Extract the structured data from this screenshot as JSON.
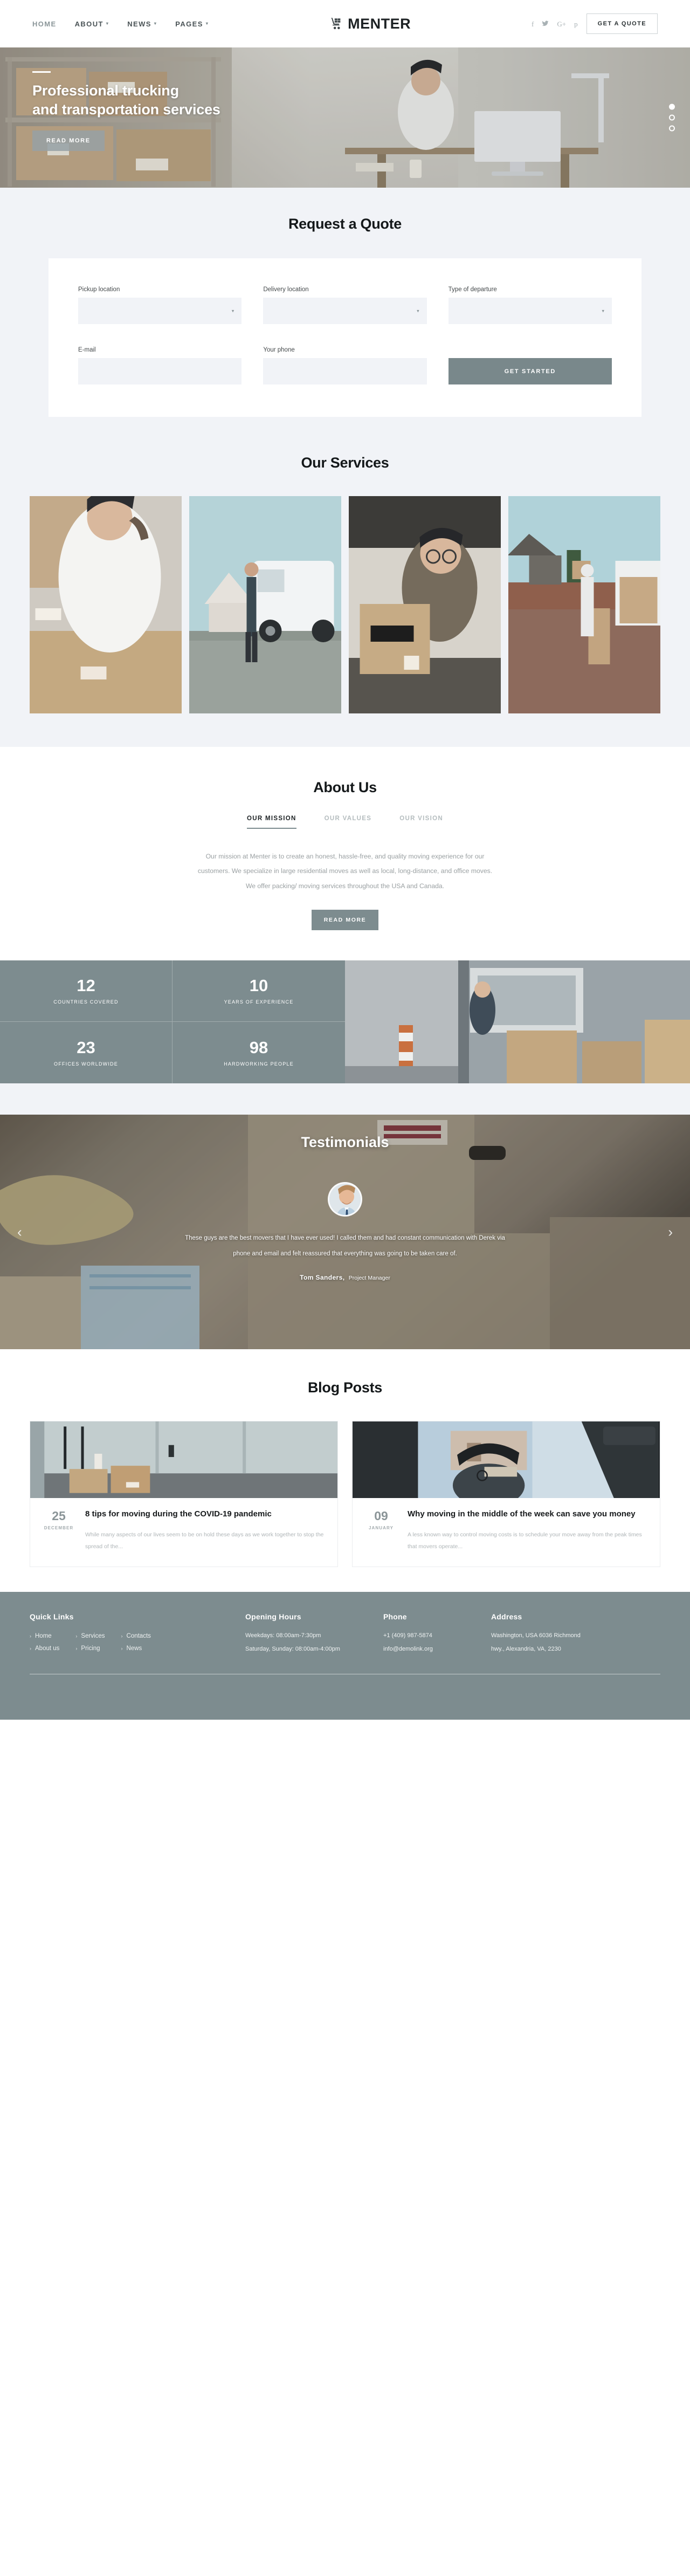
{
  "header": {
    "nav": [
      {
        "label": "HOME",
        "caret": false,
        "active": true
      },
      {
        "label": "ABOUT",
        "caret": true,
        "active": false
      },
      {
        "label": "NEWS",
        "caret": true,
        "active": false
      },
      {
        "label": "PAGES",
        "caret": true,
        "active": false
      }
    ],
    "brand_name": "MENTER",
    "socials": [
      "f",
      "t",
      "G+",
      "p"
    ],
    "quote_button": "GET A QUOTE"
  },
  "hero": {
    "title_line1": "Professional trucking",
    "title_line2": "and transportation services",
    "button": "READ MORE",
    "dots": 3,
    "active_dot": 0
  },
  "quote": {
    "title": "Request a Quote",
    "fields": {
      "pickup_label": "Pickup location",
      "pickup_value": "",
      "delivery_label": "Delivery location",
      "delivery_value": "",
      "departure_label": "Type of departure",
      "departure_value": "",
      "email_label": "E-mail",
      "email_value": "",
      "email_placeholder": "",
      "phone_label": "Your phone",
      "phone_value": "",
      "phone_placeholder": ""
    },
    "submit": "GET STARTED"
  },
  "services": {
    "title": "Our Services",
    "cards": [
      {
        "alt": "woman-taping-box"
      },
      {
        "alt": "driver-at-white-van"
      },
      {
        "alt": "worker-carrying-fragile-box"
      },
      {
        "alt": "loading-van-outdoors"
      }
    ]
  },
  "about": {
    "title": "About Us",
    "tabs": [
      {
        "label": "OUR MISSION",
        "active": true
      },
      {
        "label": "OUR VALUES",
        "active": false
      },
      {
        "label": "OUR VISION",
        "active": false
      }
    ],
    "body": "Our mission at Menter is to create an honest, hassle-free, and quality moving experience for our customers. We specialize in large residential moves as well as local, long-distance, and office moves. We offer packing/ moving services throughout the USA and Canada.",
    "button": "READ MORE"
  },
  "stats": [
    {
      "number": "12",
      "label": "COUNTRIES COVERED"
    },
    {
      "number": "10",
      "label": "YEARS OF EXPERIENCE"
    },
    {
      "number": "23",
      "label": "OFFICES WORLDWIDE"
    },
    {
      "number": "98",
      "label": "HARDWORKING PEOPLE"
    }
  ],
  "testimonials": {
    "title": "Testimonials",
    "quote": "These guys are the best movers that I have ever used! I called them and had constant communication with Derek via phone and email and felt reassured that everything was going to be taken care of.",
    "author_name": "Tom Sanders,",
    "author_role": "Project Manager",
    "prev_arrow": "‹",
    "next_arrow": "›"
  },
  "blog": {
    "title": "Blog Posts",
    "posts": [
      {
        "day": "25",
        "month": "DECEMBER",
        "title": "8 tips for moving during the COVID-19 pandemic",
        "excerpt": "While many aspects of our lives seem to be on hold these days as we work together to stop the spread of the..."
      },
      {
        "day": "09",
        "month": "JANUARY",
        "title": "Why moving in the middle of the week can save you money",
        "excerpt": "A less known way to control moving costs is to schedule your move away from the peak times that movers operate..."
      }
    ]
  },
  "footer": {
    "quick_links_title": "Quick Links",
    "quick_links_col1": [
      "Home",
      "About us"
    ],
    "quick_links_col2": [
      "Services",
      "Pricing"
    ],
    "quick_links_col3": [
      "Contacts",
      "News"
    ],
    "hours_title": "Opening Hours",
    "hours_weekday": "Weekdays: 08:00am-7:30pm",
    "hours_weekend": "Saturday, Sunday: 08:00am-4:00pm",
    "phone_title": "Phone",
    "phone_number": "+1 (409) 987-5874",
    "phone_email": "info@demolink.org",
    "address_title": "Address",
    "address_line1": "Washington, USA 6036 Richmond",
    "address_line2": "hwy., Alexandria, VA, 2230"
  },
  "colors": {
    "accent": "#7d8c8f",
    "page_bg": "#f1f3f7",
    "text_dark": "#16191b",
    "text_muted": "#9aa0a2"
  }
}
